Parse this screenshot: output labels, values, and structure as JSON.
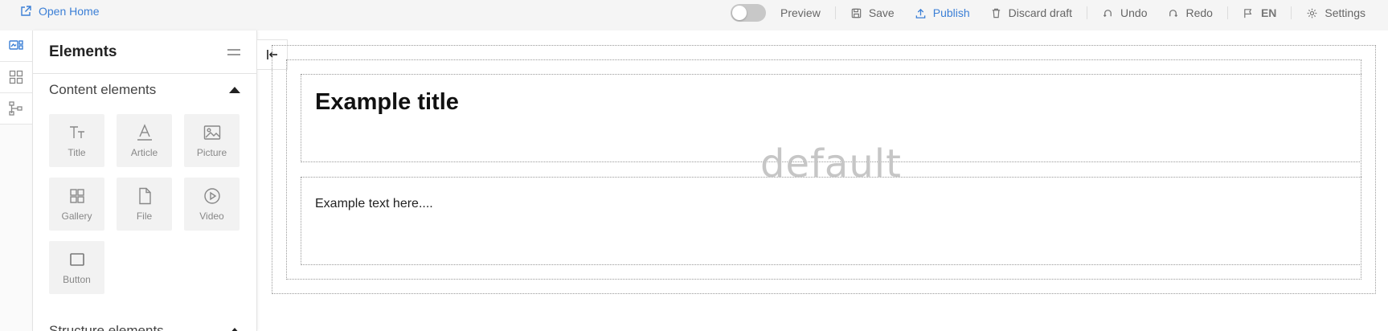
{
  "topbar": {
    "open_home": "Open Home",
    "toolbar": {
      "preview": "Preview",
      "save": "Save",
      "publish": "Publish",
      "discard": "Discard draft",
      "undo": "Undo",
      "redo": "Redo",
      "language": "EN",
      "settings": "Settings"
    },
    "preview_toggle_on": false
  },
  "rail": {
    "items": [
      {
        "icon": "elements-panel-icon",
        "active": true
      },
      {
        "icon": "grid-icon",
        "active": false
      },
      {
        "icon": "structure-tree-icon",
        "active": false
      }
    ]
  },
  "panel": {
    "title": "Elements",
    "sections": [
      {
        "title": "Content elements",
        "items": [
          {
            "label": "Title",
            "icon": "title-text-icon"
          },
          {
            "label": "Article",
            "icon": "article-a-icon"
          },
          {
            "label": "Picture",
            "icon": "picture-icon"
          },
          {
            "label": "Gallery",
            "icon": "gallery-grid-icon"
          },
          {
            "label": "File",
            "icon": "file-icon"
          },
          {
            "label": "Video",
            "icon": "play-circle-icon"
          },
          {
            "label": "Button",
            "icon": "button-square-icon"
          }
        ]
      },
      {
        "title": "Structure elements"
      }
    ]
  },
  "canvas": {
    "title_block_text": "Example title",
    "text_block_text": "Example text here....",
    "watermark": "default"
  },
  "colors": {
    "accent": "#3b7fd6",
    "topbar_bg": "#f5f5f5",
    "tile_bg": "#f2f2f2"
  }
}
